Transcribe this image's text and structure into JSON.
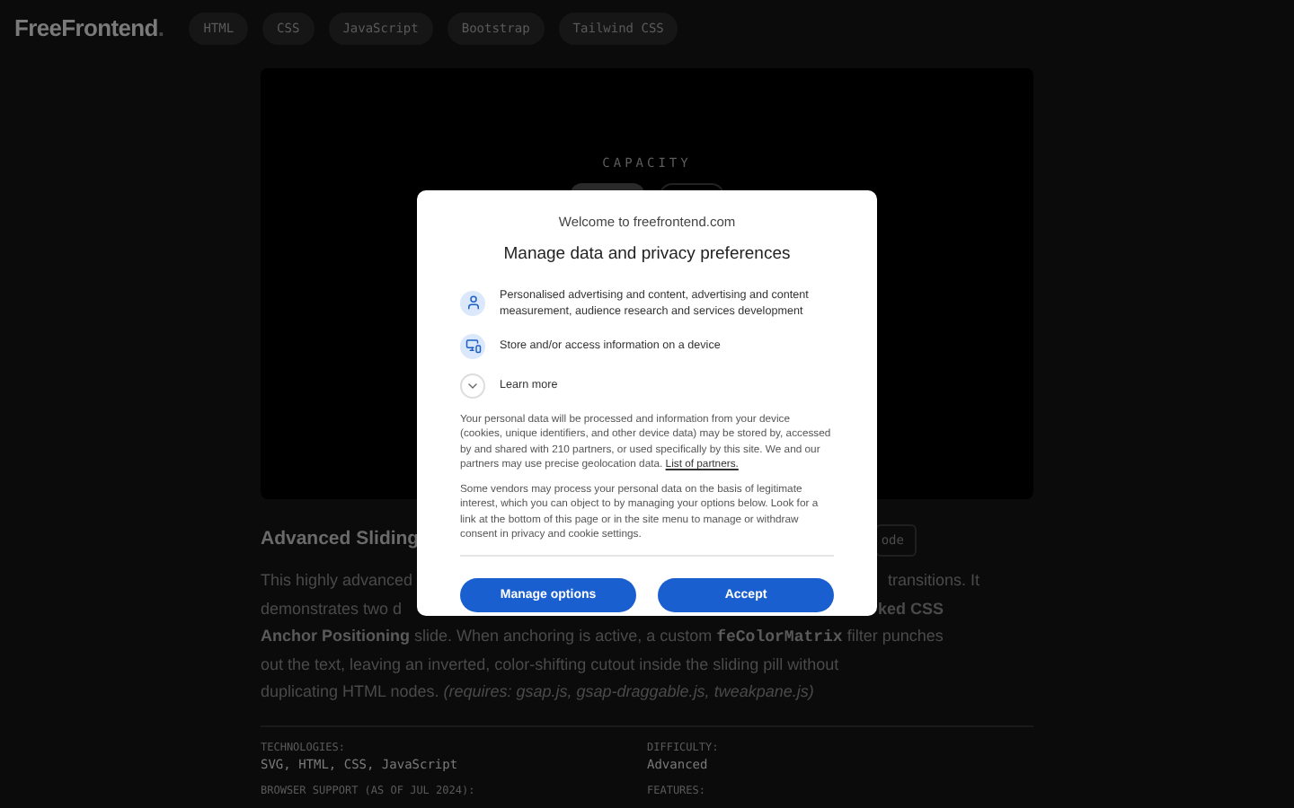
{
  "header": {
    "logo": "FreeFrontend",
    "logo_dot": ".",
    "nav": [
      "HTML",
      "CSS",
      "JavaScript",
      "Bootstrap",
      "Tailwind CSS"
    ]
  },
  "demo": {
    "label": "CAPACITY"
  },
  "article": {
    "title": "Advanced Sliding",
    "badge": "ode",
    "lines": [
      {
        "left": "This highly advanced",
        "right": "transitions. It"
      },
      {
        "left": "demonstrates two d",
        "right": "**ked CSS**"
      },
      {
        "segments": [
          {
            "kind": "bold",
            "text": "Anchor Positioning"
          },
          {
            "kind": "plain",
            "text": "slide. When anchoring is active, a custom"
          },
          {
            "kind": "code",
            "text": "feColorMatrix"
          },
          {
            "kind": "plain",
            "text": "filter punches"
          }
        ]
      },
      {
        "full": "out the text, leaving an inverted, color-shifting cutout inside the sliding pill without"
      },
      {
        "full": "duplicating HTML nodes. *(requires: gsap.js, gsap-draggable.js, tweakpane.js)*"
      }
    ]
  },
  "meta": [
    {
      "label": "TECHNOLOGIES:",
      "value": "SVG, HTML, CSS, JavaScript"
    },
    {
      "label": "DIFFICULTY:",
      "value": "Advanced"
    },
    {
      "label": "BROWSER SUPPORT (AS OF JUL 2024):"
    },
    {
      "label": "FEATURES:"
    }
  ],
  "consent": {
    "welcome": "Welcome to freefrontend.com",
    "title": "Manage data and privacy preferences",
    "purposes": [
      {
        "kind": "person",
        "text": "Personalised advertising and content, advertising and content measurement, audience research and services development"
      },
      {
        "kind": "device",
        "text": "Store and/or access information on a device"
      }
    ],
    "learn_more": "Learn more",
    "paragraph1": "Your personal data will be processed and information from your device (cookies, unique identifiers, and other device data) may be stored by, accessed by and shared with 210 partners, or used specifically by this site. We and our partners may use precise geolocation data.",
    "partners_link": "List of partners.",
    "paragraph2": "Some vendors may process your personal data on the basis of legitimate interest, which you can object to by managing your options below. Look for a link at the bottom of this page or in the site menu to manage or withdraw consent in privacy and cookie settings.",
    "buttons": [
      "Manage options",
      "Accept"
    ]
  }
}
